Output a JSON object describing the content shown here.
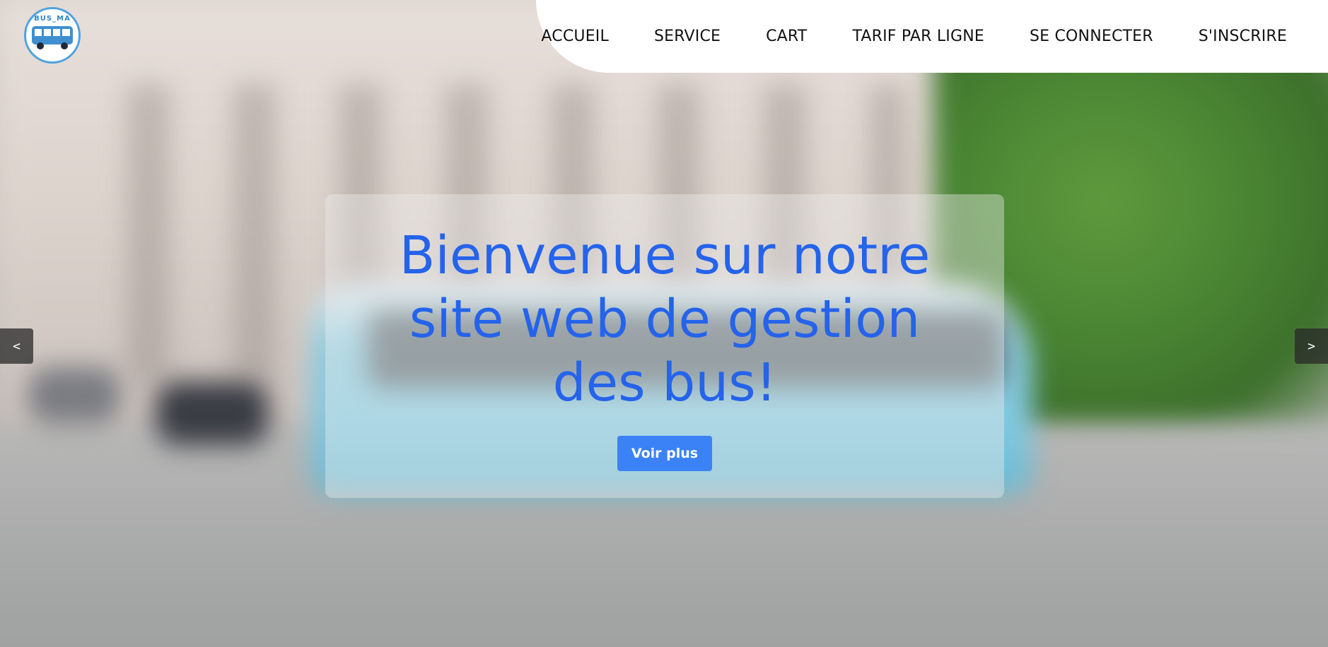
{
  "logo": {
    "text": "BUS_MA"
  },
  "nav": {
    "items": [
      {
        "label": "ACCUEIL"
      },
      {
        "label": "SERVICE"
      },
      {
        "label": "CART"
      },
      {
        "label": "TARIF PAR LIGNE"
      },
      {
        "label": "SE CONNECTER"
      },
      {
        "label": "S'INSCRIRE"
      }
    ]
  },
  "hero": {
    "title": "Bienvenue sur notre site web de gestion des bus!",
    "cta_label": "Voir plus",
    "prev_label": "<",
    "next_label": ">"
  },
  "colors": {
    "accent": "#2563eb",
    "button": "#3b82f6",
    "logo_border": "#4da3df"
  }
}
